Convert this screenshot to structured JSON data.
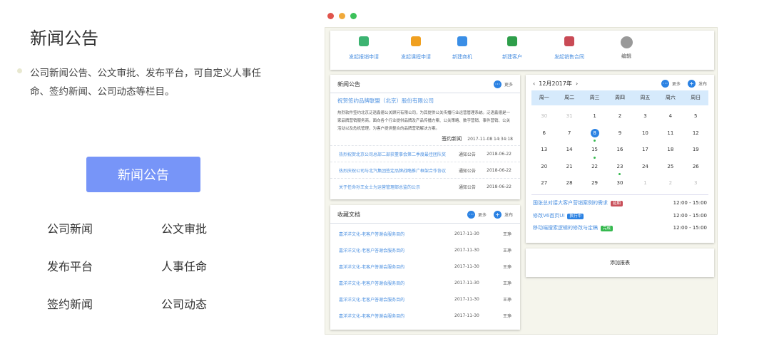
{
  "left": {
    "title": "新闻公告",
    "description": "公司新闻公告、公文审批、发布平台，可自定义人事任命、签约新闻、公司动态等栏目。",
    "button": "新闻公告",
    "categories": [
      "公司新闻",
      "公文审批",
      "发布平台",
      "人事任命",
      "签约新闻",
      "公司动态"
    ]
  },
  "window_dots": [
    "#e0544c",
    "#f0a93a",
    "#3cc15a"
  ],
  "toolbar": [
    {
      "label": "发起报销申请",
      "icon": "spreadsheet-icon",
      "color": "#3cb371"
    },
    {
      "label": "发起课程申请",
      "icon": "clock-user-icon",
      "color": "#f0a020"
    },
    {
      "label": "新建商机",
      "icon": "lightbulb-icon",
      "color": "#3a8ee6"
    },
    {
      "label": "新建客户",
      "icon": "user-icon",
      "color": "#2e9e4a"
    },
    {
      "label": "发起销售合同",
      "icon": "contract-icon",
      "color": "#c94a55"
    },
    {
      "label": "编辑",
      "icon": "edit-icon",
      "color": "#999999"
    }
  ],
  "news": {
    "title": "新闻公告",
    "more": "更多",
    "headline": "祝贺签约品牌联盟（北京）股份有限公司",
    "body": "热烈软件签约北京泛语鑫德公关顾问有限公司，为其提供公关传播行业运营管理系统。泛语鑫德是一家品牌营销服务商，面向各个行业提供品牌及产品传播方案、公关策略、数字营销、事件营销、公关活动以及危机管理，为客户提供整合的品牌营销解决方案。",
    "tag": "签约新闻",
    "time": "2017-11-08 14:34:18",
    "items": [
      {
        "title": "热烈祝贺北京公司总部二部获董事会第二季度最佳团队奖",
        "type": "通知公告",
        "date": "2018-06-22"
      },
      {
        "title": "热烈庆祝公司与北汽集团签定品牌战略推广框架合作协议",
        "type": "通知公告",
        "date": "2018-06-22"
      },
      {
        "title": "关于任命孙王女士为运营管理部总监的公示",
        "type": "通知公告",
        "date": "2018-06-22"
      }
    ]
  },
  "docs": {
    "title": "收藏文档",
    "more": "更多",
    "publish": "发布",
    "items": [
      {
        "title": "嘉洋洋文化-老客户答谢会服务目的",
        "date": "2017-11-30",
        "owner": "王琤"
      },
      {
        "title": "嘉洋洋文化-老客户答谢会服务目的",
        "date": "2017-11-30",
        "owner": "王琤"
      },
      {
        "title": "嘉洋洋文化-老客户答谢会服务目的",
        "date": "2017-11-30",
        "owner": "王琤"
      },
      {
        "title": "嘉洋洋文化-老客户答谢会服务目的",
        "date": "2017-11-30",
        "owner": "王琤"
      },
      {
        "title": "嘉洋洋文化-老客户答谢会服务目的",
        "date": "2017-11-30",
        "owner": "王琤"
      },
      {
        "title": "嘉洋洋文化-老客户答谢会服务目的",
        "date": "2017-11-30",
        "owner": "王琤"
      }
    ]
  },
  "calendar": {
    "month": "12月2017年",
    "more": "更多",
    "publish": "发布",
    "weekdays": [
      "周一",
      "周二",
      "周三",
      "周四",
      "周五",
      "周六",
      "周日"
    ],
    "days": [
      "30",
      "31",
      "1",
      "2",
      "3",
      "4",
      "5",
      "6",
      "7",
      "8",
      "9",
      "10",
      "11",
      "12",
      "13",
      "14",
      "15",
      "16",
      "17",
      "18",
      "19",
      "20",
      "21",
      "22",
      "23",
      "24",
      "25",
      "26",
      "27",
      "28",
      "29",
      "30",
      "1",
      "2",
      "3"
    ],
    "muted": [
      0,
      1,
      32,
      33,
      34
    ],
    "today": 9,
    "event_days": [
      9,
      16,
      24
    ],
    "events": [
      {
        "title": "国张总对接大客户营销案例的需求",
        "badge": "延期",
        "badge_color": "#c9505a",
        "time": "12:00 - 15:00"
      },
      {
        "title": "修改V6首页UI",
        "badge": "执行中",
        "badge_color": "#2b82e3",
        "time": "12:00 - 15:00"
      },
      {
        "title": "移动端搜索逻辑的修改与定稿",
        "badge": "完成",
        "badge_color": "#36b94f",
        "time": "12:00 - 15:00"
      }
    ]
  },
  "add_report": "添加报表"
}
